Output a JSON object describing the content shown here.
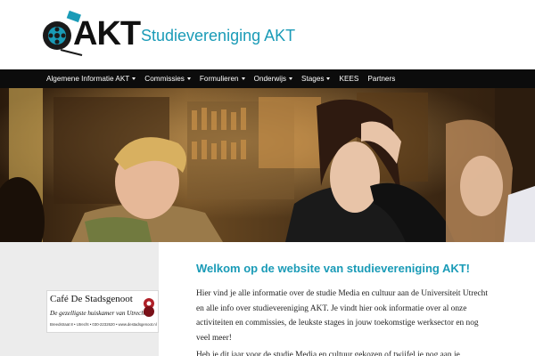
{
  "header": {
    "logo_text": "AKT",
    "site_title": "Studievereniging AKT"
  },
  "nav": {
    "items": [
      {
        "label": "Algemene Informatie AKT",
        "dropdown": true
      },
      {
        "label": "Commissies",
        "dropdown": true
      },
      {
        "label": "Formulieren",
        "dropdown": true
      },
      {
        "label": "Onderwijs",
        "dropdown": true
      },
      {
        "label": "Stages",
        "dropdown": true
      },
      {
        "label": "KEES",
        "dropdown": false
      },
      {
        "label": "Partners",
        "dropdown": false
      }
    ]
  },
  "sidebar": {
    "ad": {
      "name": "Café De Stadsgenoot",
      "tagline": "De gezelligste huiskamer van Utrecht!",
      "address": "Breedstraat 8 • Utrecht • 030-2232620 • www.destadsgenoot.nl"
    }
  },
  "main": {
    "welcome_title": "Welkom op de website van studievereniging AKT!",
    "paragraph_1": "Hier vind je alle informatie over de studie Media en cultuur aan de Universiteit Utrecht en alle info over studievereniging AKT. Je vindt hier ook informatie over al onze activiteiten en commissies, de leukste stages in jouw toekomstige werksector en nog veel meer!",
    "paragraph_2": "Heb je dit jaar voor de studie Media en cultuur gekozen of twijfel je nog aan je"
  },
  "colors": {
    "accent": "#1a9bb7",
    "nav_background": "#0c0c0c",
    "sidebar_background": "#ececec"
  }
}
